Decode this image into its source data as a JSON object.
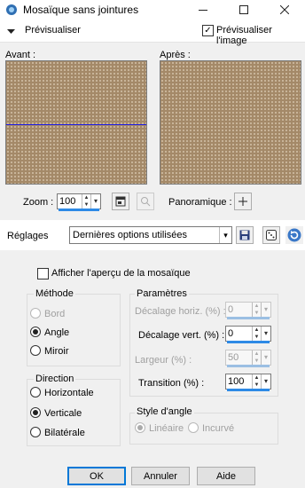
{
  "window": {
    "title": "Mosaïque sans jointures",
    "minimize_icon": "minimize-icon",
    "maximize_icon": "maximize-icon",
    "close_icon": "close-icon"
  },
  "preview_bar": {
    "collapse_label": "Prévisualiser",
    "preview_image_label": "Prévisualiser l'image",
    "preview_image_checked": true
  },
  "panels": {
    "before_label": "Avant :",
    "after_label": "Après :",
    "image_color": "#a48968"
  },
  "zoom": {
    "label": "Zoom :",
    "value": "100",
    "panoramique_label": "Panoramique :"
  },
  "settings": {
    "label": "Réglages",
    "preset_value": "Dernières options utilisées"
  },
  "options": {
    "show_tile_preview_label": "Afficher l'aperçu de la mosaïque",
    "show_tile_preview_checked": false
  },
  "method": {
    "title": "Méthode",
    "items": [
      {
        "label": "Bord",
        "selected": false,
        "disabled": true
      },
      {
        "label": "Angle",
        "selected": true,
        "disabled": false
      },
      {
        "label": "Miroir",
        "selected": false,
        "disabled": false
      }
    ]
  },
  "parameters": {
    "title": "Paramètres",
    "fields": [
      {
        "label": "Décalage horiz. (%) :",
        "value": "0",
        "disabled": true
      },
      {
        "label": "Décalage vert. (%) :",
        "value": "0",
        "disabled": false
      },
      {
        "label": "Largeur (%) :",
        "value": "50",
        "disabled": true
      },
      {
        "label": "Transition (%) :",
        "value": "100",
        "disabled": false
      }
    ]
  },
  "direction": {
    "title": "Direction",
    "items": [
      {
        "label": "Horizontale",
        "selected": false
      },
      {
        "label": "Verticale",
        "selected": true
      },
      {
        "label": "Bilatérale",
        "selected": false
      }
    ]
  },
  "corner_style": {
    "title": "Style d'angle",
    "items": [
      {
        "label": "Linéaire",
        "selected": true,
        "disabled": true
      },
      {
        "label": "Incurvé",
        "selected": false,
        "disabled": true
      }
    ]
  },
  "buttons": {
    "ok": "OK",
    "cancel": "Annuler",
    "help": "Aide"
  }
}
